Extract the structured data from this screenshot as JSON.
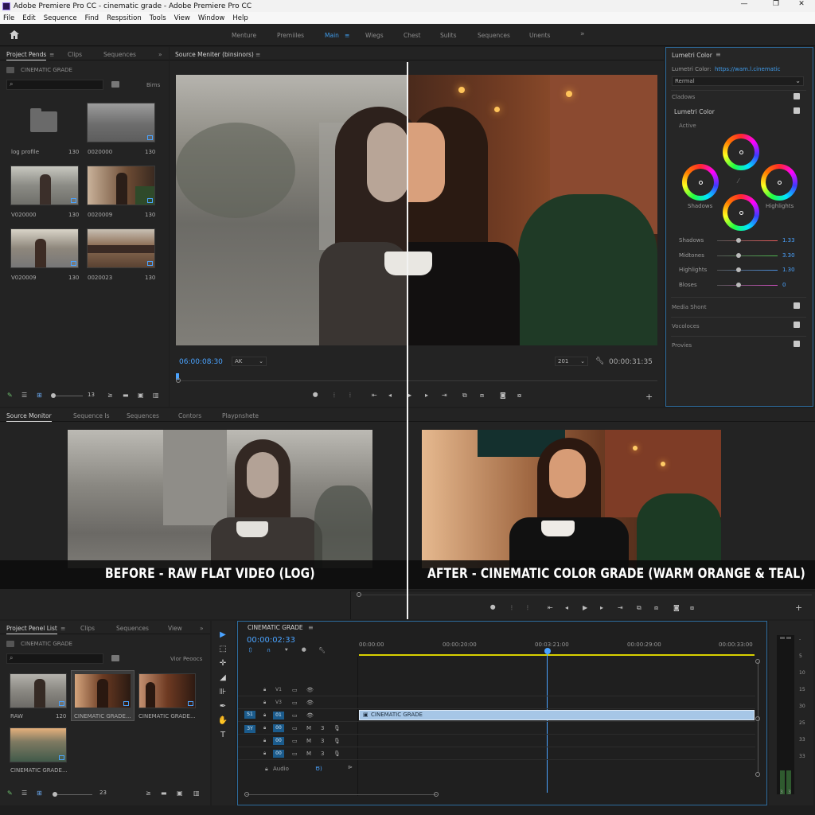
{
  "window": {
    "title": "Adobe Premiere Pro CC - cinematic grade - Adobe Premiere Pro CC",
    "controls": [
      "—",
      "❐",
      "✕"
    ]
  },
  "menu": [
    "File",
    "Edit",
    "Sequence",
    "Find",
    "Respsition",
    "Tools",
    "View",
    "Window",
    "Help"
  ],
  "workspaces": {
    "items": [
      "Menture",
      "Premiiles",
      "Main",
      "Wiegs",
      "Chest",
      "Sulits",
      "Sequences",
      "Unents"
    ],
    "active": "Main",
    "overflow": "»"
  },
  "project_panel": {
    "tabs": [
      "Project Pends",
      "Clips",
      "Sequences"
    ],
    "folder": "CINEMATIC GRADE",
    "bins_label": "Bims",
    "items": [
      {
        "name": "log profile",
        "dur": "130"
      },
      {
        "name": "0020000",
        "dur": "130"
      },
      {
        "name": "V020000",
        "dur": "130"
      },
      {
        "name": "0020009",
        "dur": "130"
      },
      {
        "name": "V020009",
        "dur": "130"
      },
      {
        "name": "0020023",
        "dur": "130"
      }
    ],
    "zoom_label": "13"
  },
  "source_monitor": {
    "tab": "Source Meniter (binsinors)",
    "timecode": "06:00:08:30",
    "fit": "AK",
    "zoom": "201",
    "duration": "00:00:31:35"
  },
  "lumetri": {
    "title": "Lumetri Color",
    "color_label": "Lumetri Color:",
    "url": "https://wam.l.cinematic",
    "preset": "Rermal",
    "sections": {
      "shadows": "Cladows",
      "lumetri": "Lumetri Color",
      "active": "Active",
      "media": "Media Shont",
      "vocoloces": "Vocoloces",
      "provies": "Provies"
    },
    "wheels": {
      "shadows": "Shadows",
      "highlights": "Highlights"
    },
    "sliders": [
      {
        "name": "Shadows",
        "value": "1.33",
        "color": "#e65a5a",
        "level": 0.36
      },
      {
        "name": "Midtones",
        "value": "3.30",
        "color": "#4fb84f",
        "level": 0.36
      },
      {
        "name": "Highlights",
        "value": "1.30",
        "color": "#4a8fe0",
        "level": 0.36
      },
      {
        "name": "Bloses",
        "value": "0",
        "color": "#cf4fbf",
        "level": 0.36
      }
    ]
  },
  "program_tabs": [
    "Source Monitor",
    "Sequence Is",
    "Sequences",
    "Contors",
    "Playpnshete"
  ],
  "captions": {
    "before": "BEFORE - RAW FLAT VIDEO (LOG)",
    "after": "AFTER - CINEMATIC COLOR GRADE (WARM ORANGE & TEAL)"
  },
  "project_list": {
    "tabs": [
      "Project Penel List",
      "Clips",
      "Sequences",
      "View"
    ],
    "folder": "CINEMATIC GRADE",
    "view_label": "Vior Peoocs",
    "items": [
      {
        "name": "RAW",
        "dur": "120"
      },
      {
        "name": "CINEMATIC GRADE...",
        "dur": ""
      },
      {
        "name": "CINEMATIC GRADE...",
        "dur": ""
      },
      {
        "name": "CINEMATIC GRADE...",
        "dur": ""
      }
    ],
    "zoom_label": "23"
  },
  "timeline": {
    "tab": "CINEMATIC GRADE",
    "timecode": "00:00:02:33",
    "ruler": [
      "00:00:00",
      "00:00:20:00",
      "00:03:21:00",
      "00:00:29:00",
      "00:00:33:00"
    ],
    "tracks": [
      {
        "id": "V1",
        "m": "",
        "three": ""
      },
      {
        "id": "V3",
        "m": "",
        "three": ""
      },
      {
        "id": "01",
        "m": "",
        "three": ""
      },
      {
        "id": "00",
        "m": "M",
        "three": "3"
      },
      {
        "id": "00",
        "m": "M",
        "three": "3"
      },
      {
        "id": "00",
        "m": "M",
        "three": "3"
      }
    ],
    "left_boxes": [
      "S1",
      "3Y"
    ],
    "audio_label": "Audio",
    "audio_value": "Ծ)",
    "clip": "CINEMATIC GRADE",
    "meter_labels": [
      "-",
      "5",
      "10",
      "15",
      "30",
      "25",
      "33",
      "33"
    ],
    "meter_bottom": [
      "3",
      "3"
    ]
  },
  "colors": {
    "accent": "#3f9bea",
    "playhead": "#4aa3ff",
    "work_area": "#d8d000",
    "clip": "#a6c6e6"
  }
}
